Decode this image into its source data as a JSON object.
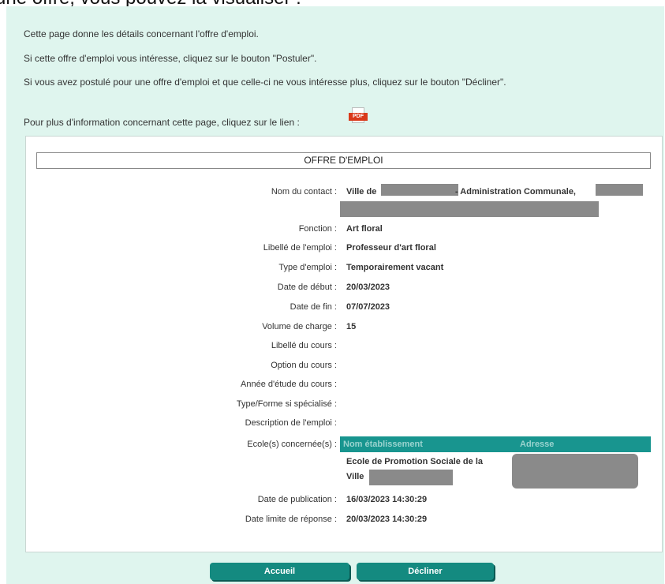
{
  "top_cut_text": "une offre, vous pouvez la visualiser :",
  "intro": {
    "line1": "Cette page donne les détails concernant l'offre d'emploi.",
    "line2": "Si cette offre d'emploi vous intéresse, cliquez sur le bouton \"Postuler\".",
    "line3": "Si vous avez postulé pour une offre d'emploi et que celle-ci ne vous intéresse plus, cliquez sur le bouton \"Décliner\".",
    "line4": "Pour plus d'information concernant cette page, cliquez sur le lien :"
  },
  "pdf_icon": {
    "label": "PDF",
    "name": "pdf-icon"
  },
  "offer": {
    "title": "OFFRE D'EMPLOI",
    "contact": {
      "label": "Nom du contact :",
      "value_a": "Ville de",
      "value_b": "- Administration Communale,"
    },
    "fields": [
      {
        "label": "Fonction :",
        "value": "Art floral"
      },
      {
        "label": "Libellé de l'emploi :",
        "value": "Professeur d'art floral"
      },
      {
        "label": "Type d'emploi :",
        "value": "Temporairement vacant"
      },
      {
        "label": "Date de début :",
        "value": "20/03/2023"
      },
      {
        "label": "Date de fin :",
        "value": "07/07/2023"
      },
      {
        "label": "Volume de charge :",
        "value": "15"
      },
      {
        "label": "Libellé du cours :",
        "value": ""
      },
      {
        "label": "Option du cours :",
        "value": ""
      },
      {
        "label": "Année d'étude du cours :",
        "value": ""
      },
      {
        "label": "Type/Forme si spécialisé :",
        "value": ""
      },
      {
        "label": "Description de l'emploi :",
        "value": ""
      }
    ],
    "ecoles": {
      "label": "Ecole(s) concernée(s) :",
      "col_name": "Nom établissement",
      "col_address": "Adresse",
      "school_name_line1": "Ecole de Promotion Sociale de la",
      "school_name_line2": "Ville"
    },
    "publication": {
      "label": "Date de publication :",
      "value": "16/03/2023 14:30:29"
    },
    "deadline": {
      "label": "Date limite de réponse :",
      "value": "20/03/2023 14:30:29"
    }
  },
  "buttons": {
    "home": "Accueil",
    "decline": "Décliner"
  },
  "colors": {
    "panel_bg": "#dff5ee",
    "teal": "#148a80",
    "pdf_red": "#d9391a"
  }
}
